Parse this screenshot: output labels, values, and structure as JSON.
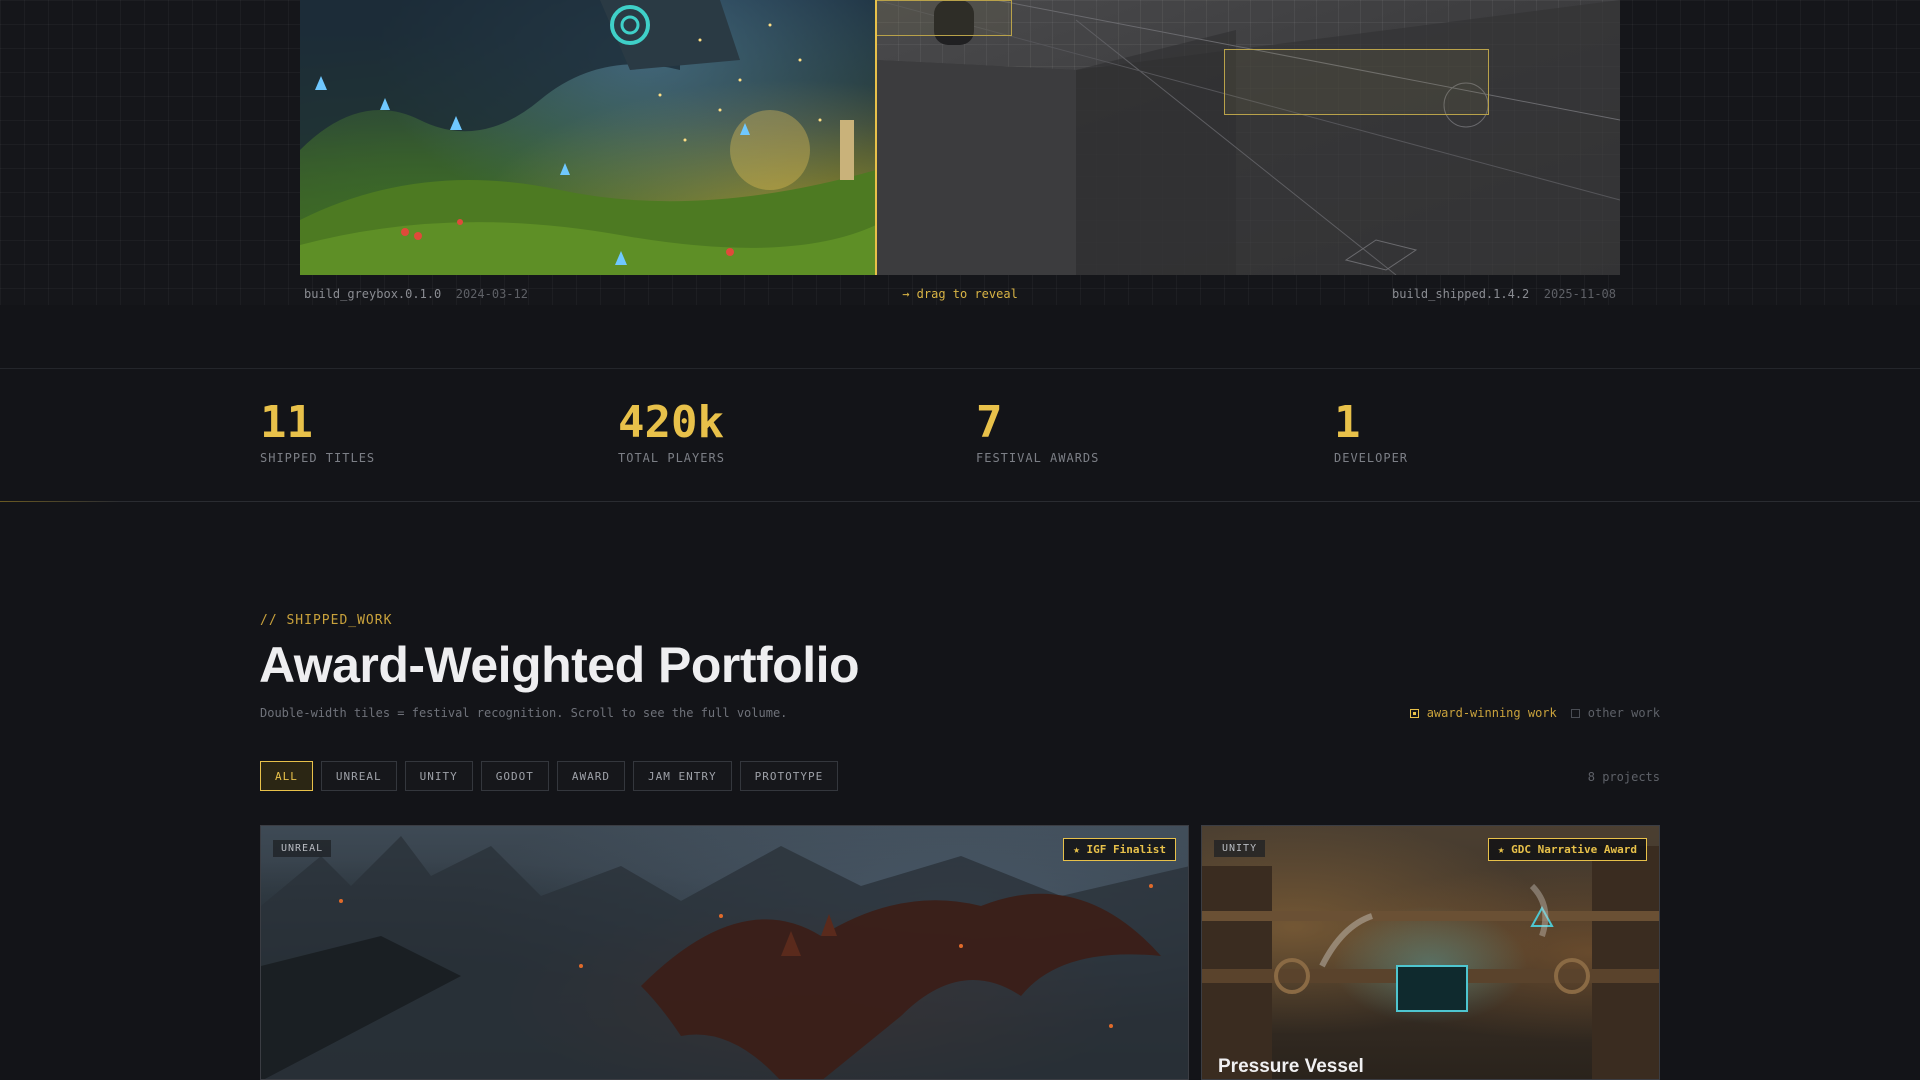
{
  "hero": {
    "left_build": "build_greybox.0.1.0",
    "left_date": "2024-03-12",
    "drag_hint": "→ drag to reveal",
    "right_build": "build_shipped.1.4.2",
    "right_date": "2025-11-08"
  },
  "stats": [
    {
      "value": "11",
      "label": "SHIPPED TITLES"
    },
    {
      "value": "420k",
      "label": "TOTAL PLAYERS"
    },
    {
      "value": "7",
      "label": "FESTIVAL AWARDS"
    },
    {
      "value": "1",
      "label": "DEVELOPER"
    }
  ],
  "section": {
    "eyebrow": "// SHIPPED_WORK",
    "title": "Award-Weighted Portfolio",
    "subtitle": "Double-width tiles = festival recognition. Scroll to see the full volume.",
    "legend_award": "award-winning work",
    "legend_other": "other work"
  },
  "filters": {
    "items": [
      "ALL",
      "UNREAL",
      "UNITY",
      "GODOT",
      "AWARD",
      "JAM ENTRY",
      "PROTOTYPE"
    ],
    "active": "ALL",
    "count": "8 projects"
  },
  "cards": [
    {
      "engine": "UNREAL",
      "award": "★ IGF Finalist",
      "title": ""
    },
    {
      "engine": "UNITY",
      "award": "★ GDC Narrative Award",
      "title": "Pressure Vessel"
    }
  ],
  "colors": {
    "accent": "#e8c14a",
    "background": "#131418"
  }
}
